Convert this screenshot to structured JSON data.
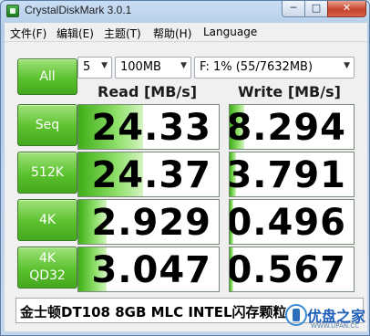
{
  "window": {
    "title": "CrystalDiskMark 3.0.1",
    "min_label": "─",
    "max_label": "□",
    "close_label": "✕"
  },
  "menu": [
    "文件(F)",
    "编辑(E)",
    "主题(T)",
    "帮助(H)",
    "Language"
  ],
  "controls": {
    "all_label": "All",
    "count": "5",
    "size": "100MB",
    "drive": "F: 1% (55/7632MB)"
  },
  "headers": {
    "read": "Read [MB/s]",
    "write": "Write [MB/s]"
  },
  "rows": [
    {
      "label_line1": "Seq",
      "label_line2": "",
      "read": "24.33",
      "write": "8.294"
    },
    {
      "label_line1": "512K",
      "label_line2": "",
      "read": "24.37",
      "write": "3.791"
    },
    {
      "label_line1": "4K",
      "label_line2": "",
      "read": "2.929",
      "write": "0.496"
    },
    {
      "label_line1": "4K",
      "label_line2": "QD32",
      "read": "3.047",
      "write": "0.567"
    }
  ],
  "comment": "金士顿DT108 8GB MLC INTEL闪存颗粒",
  "watermark": {
    "text": "优盘之家",
    "url": "WWW.UPAN.CC"
  },
  "colors": {
    "accent_green": "#5bc12e",
    "title_bg": "#b5cde8"
  }
}
